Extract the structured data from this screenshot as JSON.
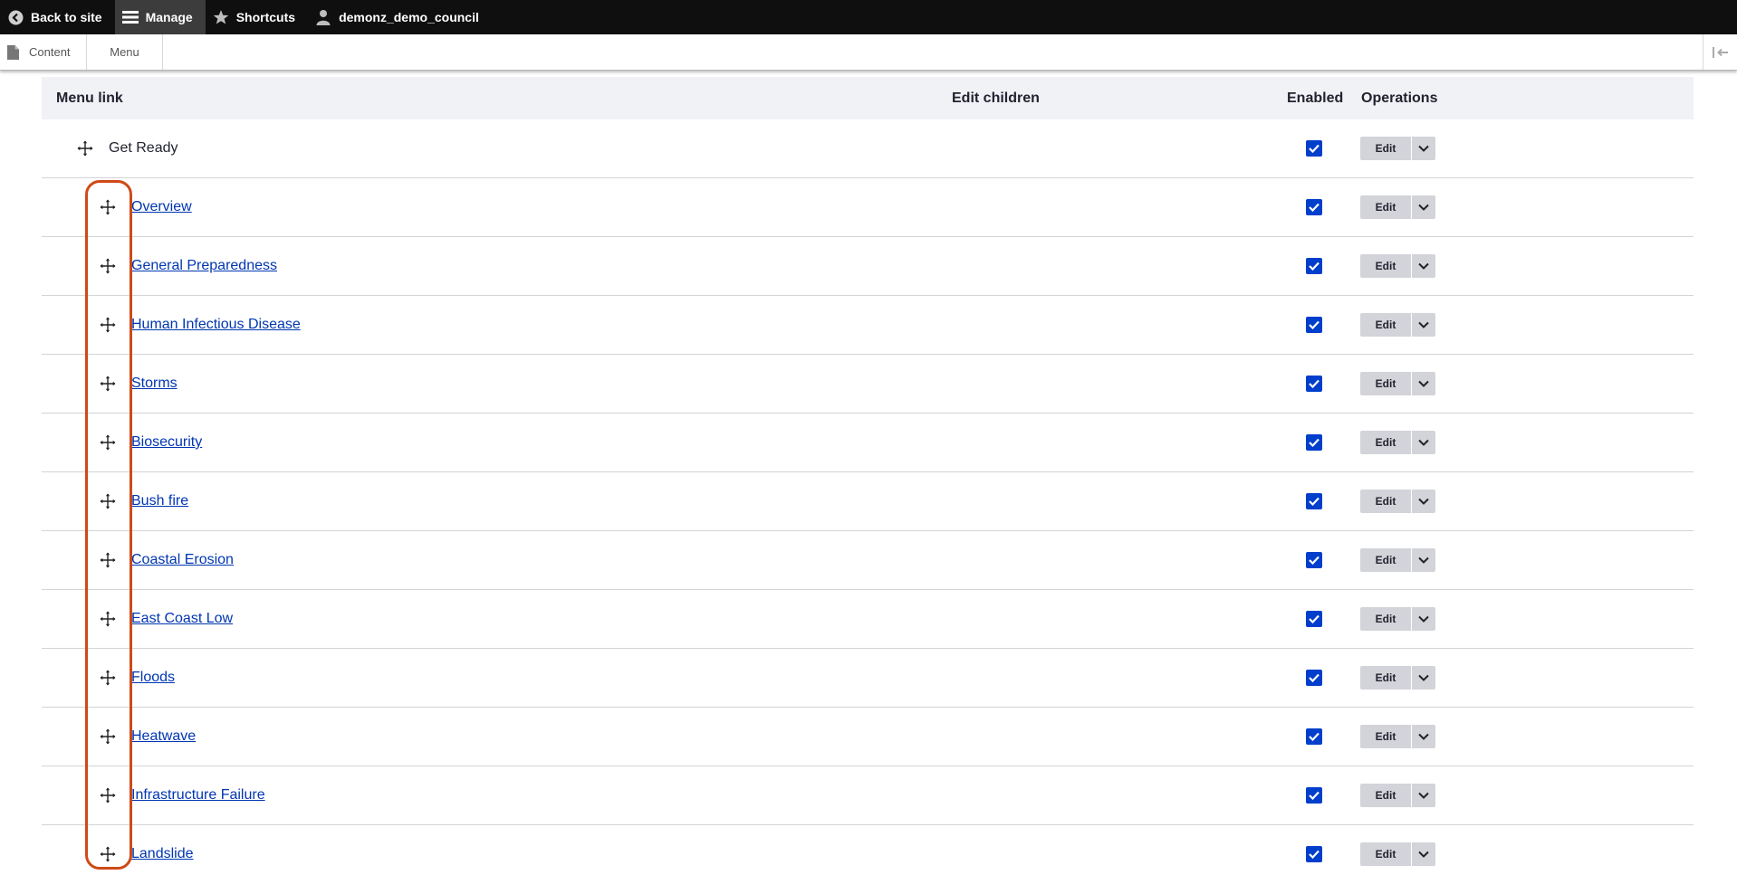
{
  "toolbar": {
    "back_to_site": "Back to site",
    "manage": "Manage",
    "shortcuts": "Shortcuts",
    "user": "demonz_demo_council",
    "icons": {
      "back": "back-arrow-circle-icon",
      "manage": "hamburger-menu-icon",
      "shortcuts": "star-icon",
      "user": "user-icon"
    }
  },
  "tray": {
    "content": "Content",
    "menu": "Menu",
    "toggle_icon": "collapse-toggle-icon"
  },
  "table": {
    "headers": {
      "menu_link": "Menu link",
      "edit_children": "Edit children",
      "enabled": "Enabled",
      "operations": "Operations"
    },
    "rows": [
      {
        "label": "Get Ready",
        "is_link": false,
        "enabled": true,
        "edit": "Edit"
      },
      {
        "label": "Overview",
        "is_link": true,
        "enabled": true,
        "edit": "Edit"
      },
      {
        "label": "General Preparedness",
        "is_link": true,
        "enabled": true,
        "edit": "Edit"
      },
      {
        "label": "Human Infectious Disease",
        "is_link": true,
        "enabled": true,
        "edit": "Edit"
      },
      {
        "label": "Storms",
        "is_link": true,
        "enabled": true,
        "edit": "Edit"
      },
      {
        "label": "Biosecurity",
        "is_link": true,
        "enabled": true,
        "edit": "Edit"
      },
      {
        "label": "Bush fire",
        "is_link": true,
        "enabled": true,
        "edit": "Edit"
      },
      {
        "label": "Coastal Erosion",
        "is_link": true,
        "enabled": true,
        "edit": "Edit"
      },
      {
        "label": "East Coast Low",
        "is_link": true,
        "enabled": true,
        "edit": "Edit"
      },
      {
        "label": "Floods",
        "is_link": true,
        "enabled": true,
        "edit": "Edit"
      },
      {
        "label": "Heatwave",
        "is_link": true,
        "enabled": true,
        "edit": "Edit"
      },
      {
        "label": "Infrastructure Failure",
        "is_link": true,
        "enabled": true,
        "edit": "Edit"
      },
      {
        "label": "Landslide",
        "is_link": true,
        "enabled": true,
        "edit": "Edit"
      }
    ]
  },
  "colors": {
    "toolbar_bg": "#0f0f0f",
    "link": "#0036b1",
    "checkbox": "#003ecc",
    "highlight": "#cf4a17",
    "header_bg": "#f1f2f6"
  }
}
